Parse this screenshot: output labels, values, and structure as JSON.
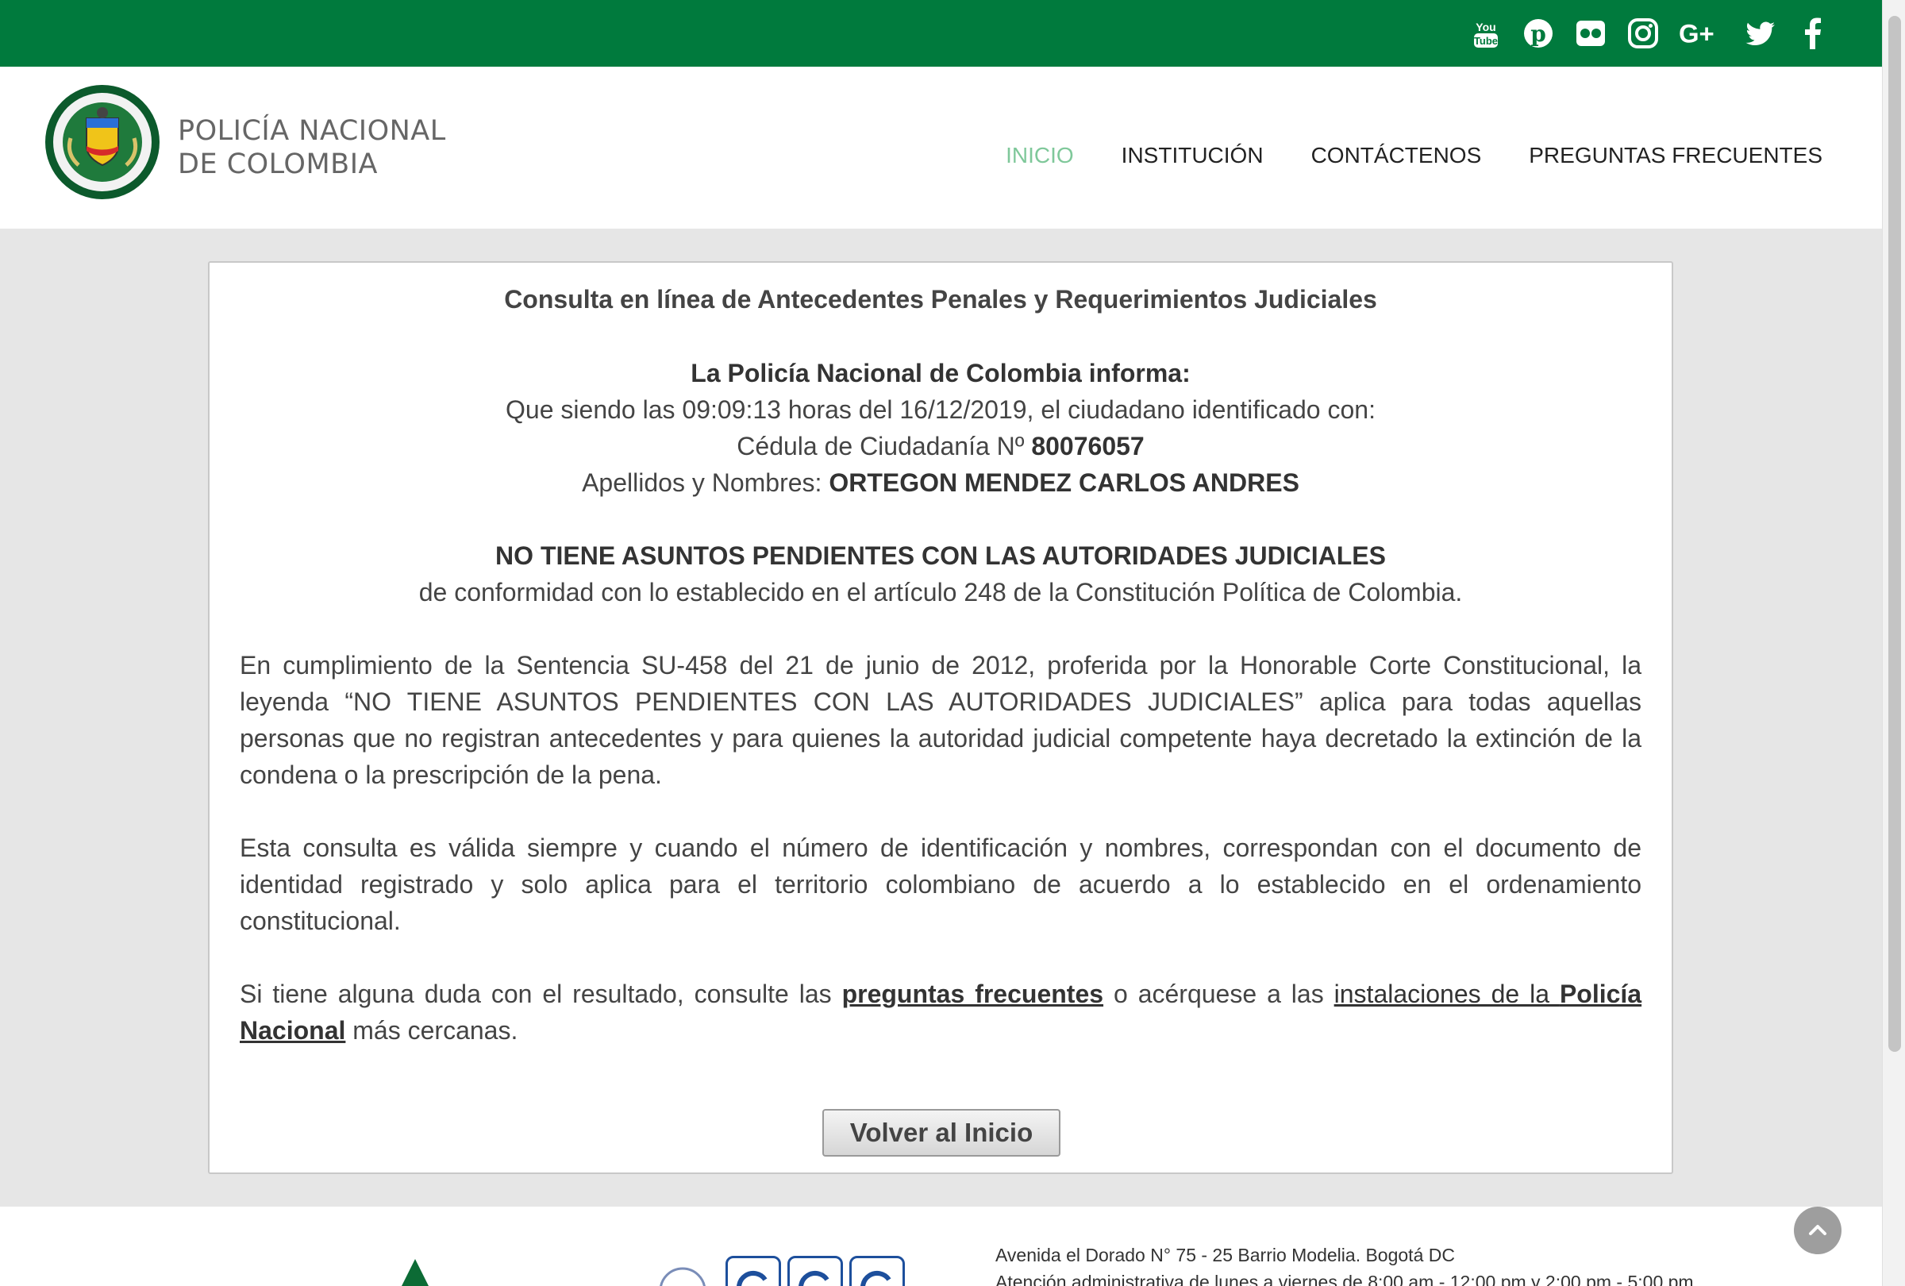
{
  "social": [
    "youtube-icon",
    "pinterest-icon",
    "flickr-icon",
    "instagram-icon",
    "google-plus-icon",
    "twitter-icon",
    "facebook-icon"
  ],
  "header": {
    "logo_line1": "POLICÍA NACIONAL",
    "logo_line2": "DE COLOMBIA",
    "nav": [
      "INICIO",
      "INSTITUCIÓN",
      "CONTÁCTENOS",
      "PREGUNTAS FRECUENTES"
    ]
  },
  "panel": {
    "title": "Consulta en línea de Antecedentes Penales y Requerimientos Judiciales",
    "informa": "La Policía Nacional de Colombia informa:",
    "line_time": "Que siendo las 09:09:13 horas del 16/12/2019, el ciudadano identificado con:",
    "cedula_label": "Cédula de Ciudadanía Nº",
    "cedula_number": "80076057",
    "names_label": "Apellidos y Nombres:",
    "names_value": "ORTEGON MENDEZ CARLOS ANDRES",
    "result": "NO TIENE ASUNTOS PENDIENTES CON LAS AUTORIDADES JUDICIALES",
    "result_note": "de conformidad con lo establecido en el artículo 248 de la Constitución Política de Colombia.",
    "para1": "En cumplimiento de la Sentencia SU-458 del 21 de junio de 2012, proferida por la Honorable Corte Constitucional, la leyenda “NO TIENE ASUNTOS PENDIENTES CON LAS AUTORIDADES JUDICIALES” aplica para todas aquellas personas que no registran antecedentes y para quienes la autoridad judicial competente haya decretado la extinción de la condena o la prescripción de la pena.",
    "para2": "Esta consulta es válida siempre y cuando el número de identificación y nombres, correspondan con el documento de identidad registrado y solo aplica para el territorio colombiano de acuerdo a lo establecido en el ordenamiento constitucional.",
    "para3_a": "Si tiene alguna duda con el resultado, consulte las",
    "para3_link1": "preguntas frecuentes",
    "para3_b": "o acérquese a las",
    "para3_link2a": "instalaciones de la",
    "para3_link2b": "Policía Nacional",
    "para3_c": "más cercanas.",
    "button": "Volver al Inicio"
  },
  "footer": {
    "address": "Avenida el Dorado N° 75 - 25 Barrio Modelia. Bogotá DC",
    "hours": "Atención administrativa de lunes a viernes de 8:00 am - 12:00 pm y 2:00 pm - 5:00 pm"
  },
  "colors": {
    "topbar": "#007a3d",
    "nav_active": "#7fc89a"
  }
}
